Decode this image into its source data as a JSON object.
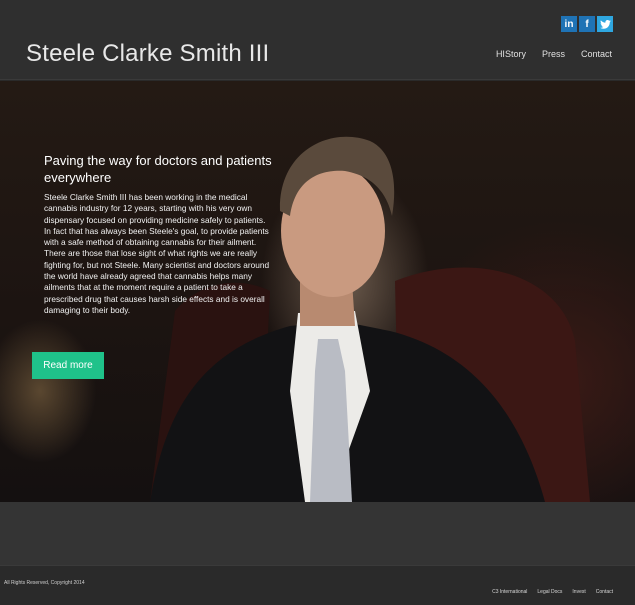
{
  "header": {
    "site_title": "Steele Clarke Smith III",
    "social": {
      "linkedin": "in",
      "facebook": "f",
      "twitter": "t"
    },
    "nav": [
      "HIStory",
      "Press",
      "Contact"
    ]
  },
  "hero": {
    "heading": "Paving the way for doctors and patients everywhere",
    "body": "Steele Clarke Smith III has been working in the medical cannabis industry for 12 years, starting with his very own dispensary focused on providing medicine safely to patients. In fact that has always been Steele's goal, to provide patients with a safe method of obtaining cannabis for their ailment. There are those that lose sight of what rights we are really fighting for, but not Steele. Many scientist and doctors around the world have already agreed that cannabis helps many ailments that at the moment require a patient to take a prescribed drug that causes harsh side effects and is overall damaging to their body.",
    "cta_label": "Read more"
  },
  "footer": {
    "copyright": "All Rights Reserved, Copyright 2014",
    "links": [
      "C3 International",
      "Legal Docs",
      "Invest",
      "Contact"
    ]
  },
  "colors": {
    "accent": "#1fc28a",
    "linkedin": "#1f73b5",
    "twitter": "#2fa7e0"
  }
}
